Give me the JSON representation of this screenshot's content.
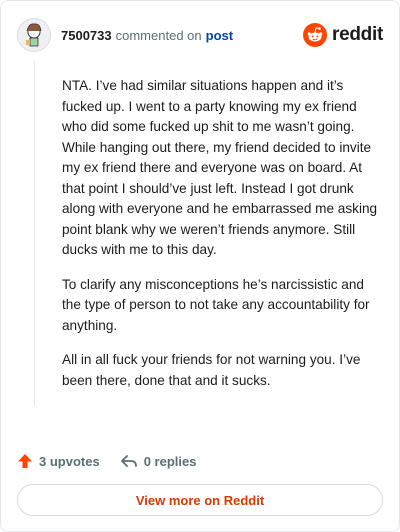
{
  "comment": {
    "username": "7500733",
    "action": "commented on",
    "link": "post",
    "paragraphs": [
      "NTA. I’ve had similar situations happen and it’s fucked up. I went to a party knowing my ex friend who did some fucked up shit to me wasn’t going. While hanging out there, my friend decided to invite my ex friend there and everyone was on board. At that point I should’ve just left. Instead I got drunk along with everyone and he embarrassed me asking point blank why we weren’t friends anymore. Still ducks with me to this day.",
      "To clarify any misconceptions he’s narcissistic and the type of person to not take any accountability for anything.",
      "All in all fuck your friends for not warning you. I’ve been there, done that and it sucks."
    ]
  },
  "brand": {
    "wordmark": "reddit",
    "color": "#ff4500",
    "icon": "reddit-logo-icon"
  },
  "actions": {
    "upvotes": "3 upvotes",
    "replies": "0 replies",
    "upvote_icon": "upvote-arrow-icon",
    "reply_icon": "reply-arrow-icon",
    "upvote_color": "#ff4500"
  },
  "footer": {
    "view_more": "View more on Reddit",
    "view_more_color": "#d93a00"
  }
}
